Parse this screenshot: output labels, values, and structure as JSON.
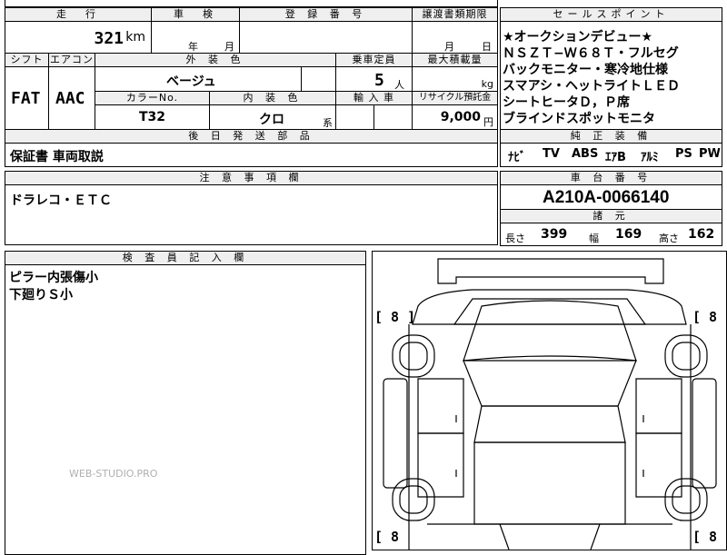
{
  "top": {
    "mileage_header": "走　行",
    "mileage_value": "321",
    "mileage_unit": "km",
    "inspection_header": "車　検",
    "inspection_year_unit": "年",
    "inspection_month_unit": "月",
    "registration_header": "登 録 番 号",
    "transfer_header": "譲渡書類期限",
    "transfer_month_unit": "月",
    "transfer_day_unit": "日"
  },
  "specs": {
    "shift_header": "シフト",
    "shift_value": "FAT",
    "aircon_header": "エアコン",
    "aircon_value": "AAC",
    "exterior_header": "外 装 色",
    "exterior_value": "ベージュ",
    "capacity_header": "乗車定員",
    "capacity_value": "5",
    "capacity_unit": "人",
    "max_load_header": "最大積載量",
    "max_load_unit": "kg",
    "color_no_header": "カラーNo.",
    "color_no_value": "T32",
    "interior_header": "内 装 色",
    "interior_value": "クロ",
    "interior_suffix": "系",
    "import_header": "輸 入 車",
    "recycle_header": "リサイクル預託金",
    "recycle_value": "9,000",
    "recycle_unit": "円"
  },
  "later_parts": {
    "header": "後 日 発 送 部 品",
    "value": "保証書 車両取説"
  },
  "notes": {
    "header": "注 意 事 項 欄",
    "value": "ドラレコ・ＥＴＣ"
  },
  "inspector": {
    "header": "検 査 員 記 入 欄",
    "lines": [
      "ピラー内張傷小",
      "下廻りＳ小"
    ]
  },
  "sales_points": {
    "header": "セールスポイント",
    "lines": [
      "★オークションデビュー★",
      "ＮＳＺＴ−Ｗ６８Ｔ・フルセグ",
      "バックモニター・寒冷地仕様",
      "スマアシ・ヘットライトＬＥＤ",
      "シートヒータＤ，Ｐ席",
      "ブラインドスポットモニタ"
    ]
  },
  "equipment": {
    "header": "純 正 装 備",
    "items": [
      "ﾅﾋﾞ",
      "TV",
      "ABS",
      "ｴｱB",
      "ｱﾙﾐ",
      "PS",
      "PW"
    ]
  },
  "chassis": {
    "header": "車 台 番 号",
    "value": "A210A-0066140"
  },
  "dimensions": {
    "header": "諸 元",
    "length_label": "長さ",
    "length_value": "399",
    "width_label": "幅",
    "width_value": "169",
    "height_label": "高さ",
    "height_value": "162"
  },
  "diagram": {
    "tire_front_left": "[ 8 ]",
    "tire_front_right": "[ 8 ]",
    "tire_rear_left": "[ 8",
    "tire_rear_right": "[ 8"
  },
  "watermark": "WEB-STUDIO.PRO"
}
